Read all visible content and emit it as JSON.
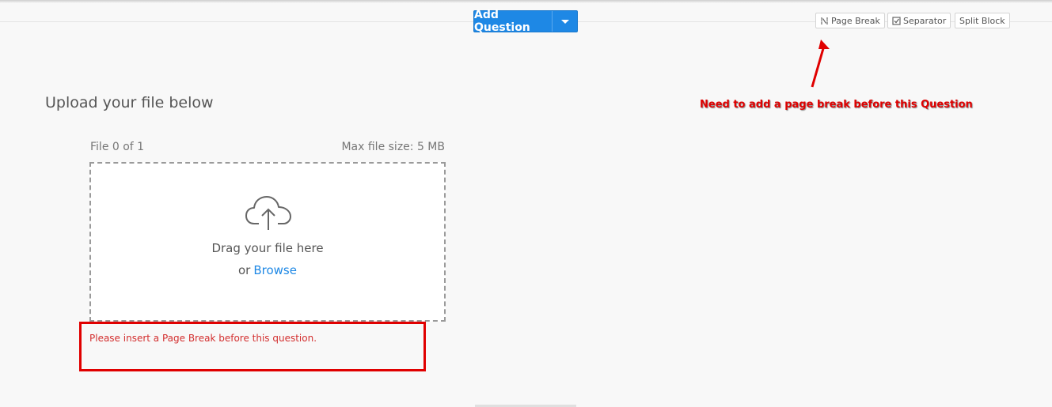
{
  "toolbar": {
    "add_question_label": "Add Question",
    "page_break_label": "Page Break",
    "separator_label": "Separator",
    "split_block_label": "Split Block"
  },
  "question": {
    "title": "Upload your file below",
    "file_count": "File 0 of 1",
    "max_size": "Max file size: 5 MB",
    "drag_text": "Drag your file here",
    "or_text": "or",
    "browse_label": "Browse",
    "error_message": "Please insert a Page Break before this question."
  },
  "annotation": {
    "text": "Need to add a page break before this Question"
  },
  "colors": {
    "accent": "#1e88e5",
    "error": "#d32f2f",
    "annotation": "#e00000"
  },
  "icons": [
    "chevron-down-icon",
    "page-break-icon",
    "checkbox-icon",
    "cloud-upload-icon",
    "red-arrow-icon"
  ]
}
